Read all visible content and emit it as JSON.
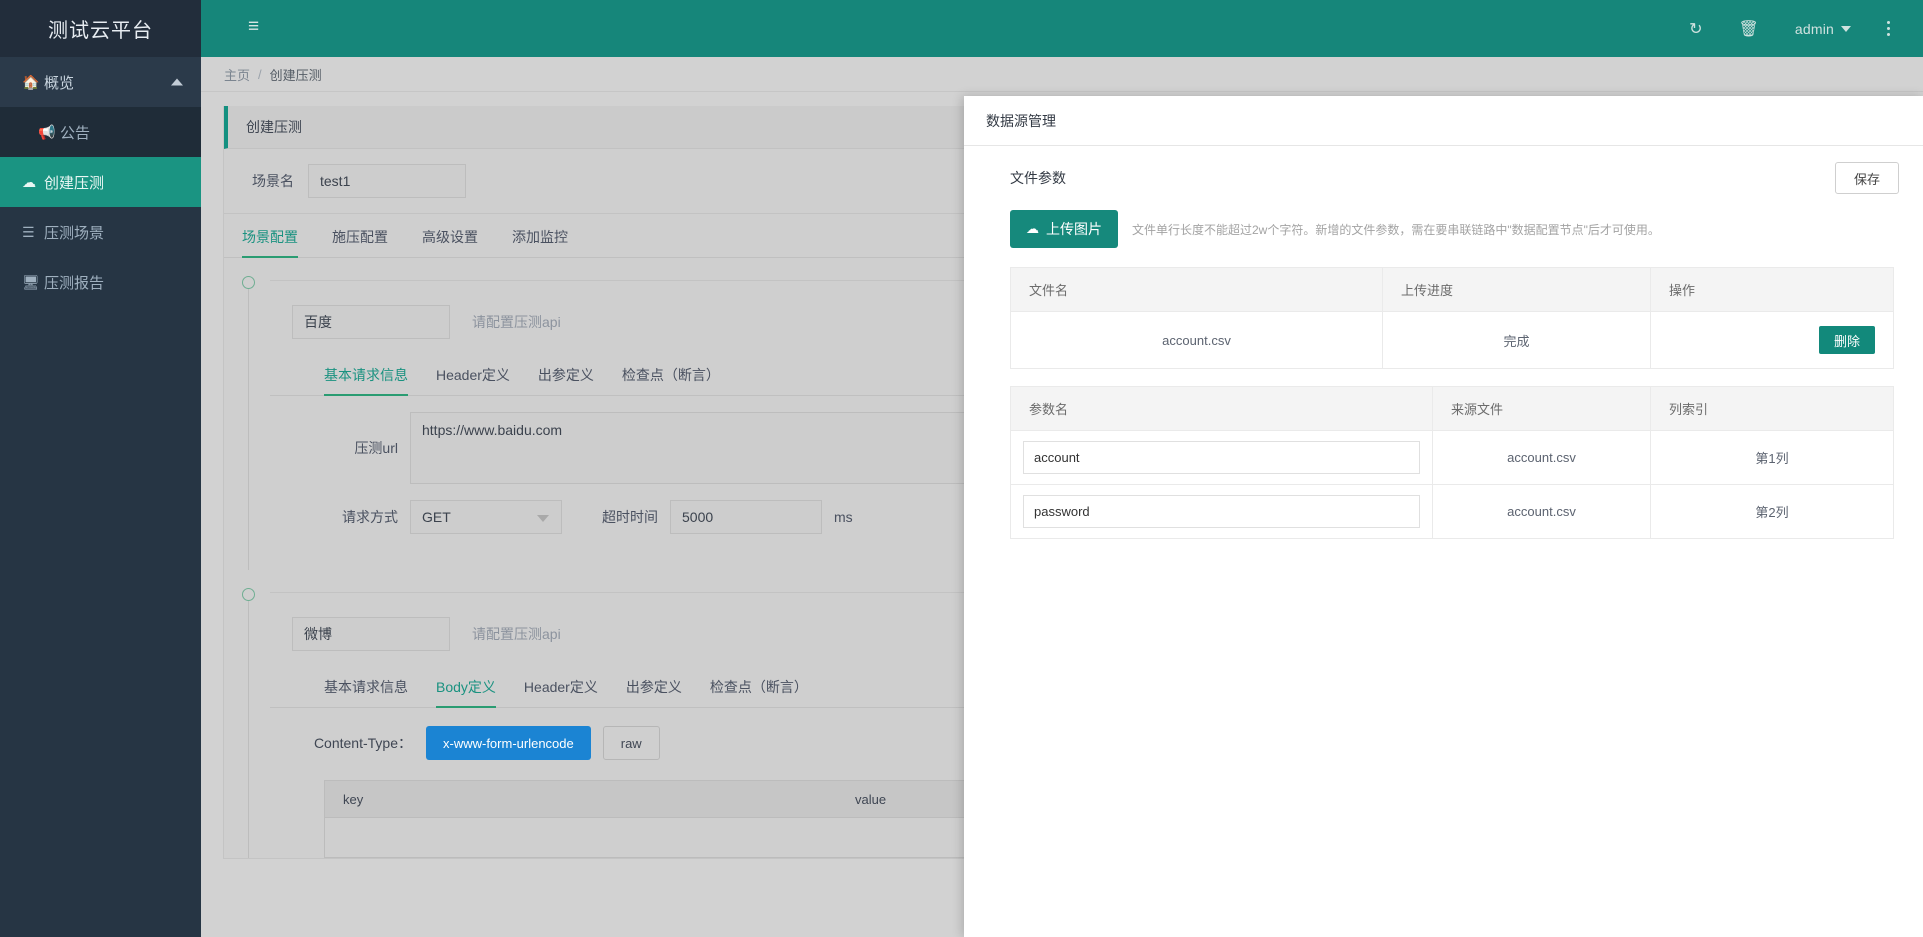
{
  "sidebar": {
    "brand": "测试云平台",
    "items": [
      {
        "label": "概览",
        "icon": "home-icon",
        "state": "group"
      },
      {
        "label": "公告",
        "icon": "megaphone-icon",
        "state": "sub"
      },
      {
        "label": "创建压测",
        "icon": "cloud-icon",
        "state": "active"
      },
      {
        "label": "压测场景",
        "icon": "list-icon",
        "state": "normal"
      },
      {
        "label": "压测报告",
        "icon": "monitor-icon",
        "state": "normal"
      }
    ]
  },
  "topbar": {
    "menu_icon": "hamburger-icon",
    "refresh_icon": "refresh-icon",
    "trash_icon": "trash-icon",
    "user": "admin",
    "more_icon": "vertical-dots-icon",
    "bg": "#16867a"
  },
  "breadcrumb": {
    "home": "主页",
    "sep": "/",
    "current": "创建压测"
  },
  "panel": {
    "title": "创建压测",
    "scene_label": "场景名",
    "scene_value": "test1",
    "tabs": [
      {
        "label": "场景配置",
        "active": true
      },
      {
        "label": "施压配置",
        "active": false
      },
      {
        "label": "高级设置",
        "active": false
      },
      {
        "label": "添加监控",
        "active": false
      }
    ]
  },
  "node1": {
    "api_name": "百度",
    "api_hint": "请配置压测api",
    "subtabs": [
      {
        "label": "基本请求信息",
        "active": true
      },
      {
        "label": "Header定义",
        "active": false
      },
      {
        "label": "出参定义",
        "active": false
      },
      {
        "label": "检查点（断言）",
        "active": false
      }
    ],
    "url_label": "压测url",
    "url_value": "https://www.baidu.com",
    "method_label": "请求方式",
    "method_value": "GET",
    "timeout_label": "超时时间",
    "timeout_value": "5000",
    "timeout_unit": "ms"
  },
  "node2": {
    "api_name": "微博",
    "api_hint": "请配置压测api",
    "subtabs": [
      {
        "label": "基本请求信息",
        "active": false
      },
      {
        "label": "Body定义",
        "active": true
      },
      {
        "label": "Header定义",
        "active": false
      },
      {
        "label": "出参定义",
        "active": false
      },
      {
        "label": "检查点（断言）",
        "active": false
      }
    ],
    "content_type_label": "Content-Type：",
    "ct_primary": "x-www-form-urlencode",
    "ct_secondary": "raw",
    "kv_key": "key",
    "kv_value": "value"
  },
  "modal": {
    "title": "数据源管理",
    "section_title": "文件参数",
    "save_label": "保存",
    "upload_label": "上传图片",
    "upload_icon": "cloud-upload-icon",
    "hint": "文件单行长度不能超过2w个字符。新增的文件参数，需在要串联链路中\"数据配置节点\"后才可使用。",
    "file_table": {
      "headers": [
        "文件名",
        "上传进度",
        "操作"
      ],
      "rows": [
        {
          "name": "account.csv",
          "progress": "完成",
          "action": "删除"
        }
      ]
    },
    "param_table": {
      "headers": [
        "参数名",
        "来源文件",
        "列索引"
      ],
      "rows": [
        {
          "param": "account",
          "source": "account.csv",
          "col": "第1列"
        },
        {
          "param": "password",
          "source": "account.csv",
          "col": "第2列"
        }
      ]
    }
  },
  "colors": {
    "brand": "#16867a",
    "sidebar": "#263544",
    "accent_green": "#1a9482",
    "accent_blue": "#1b84d3"
  }
}
